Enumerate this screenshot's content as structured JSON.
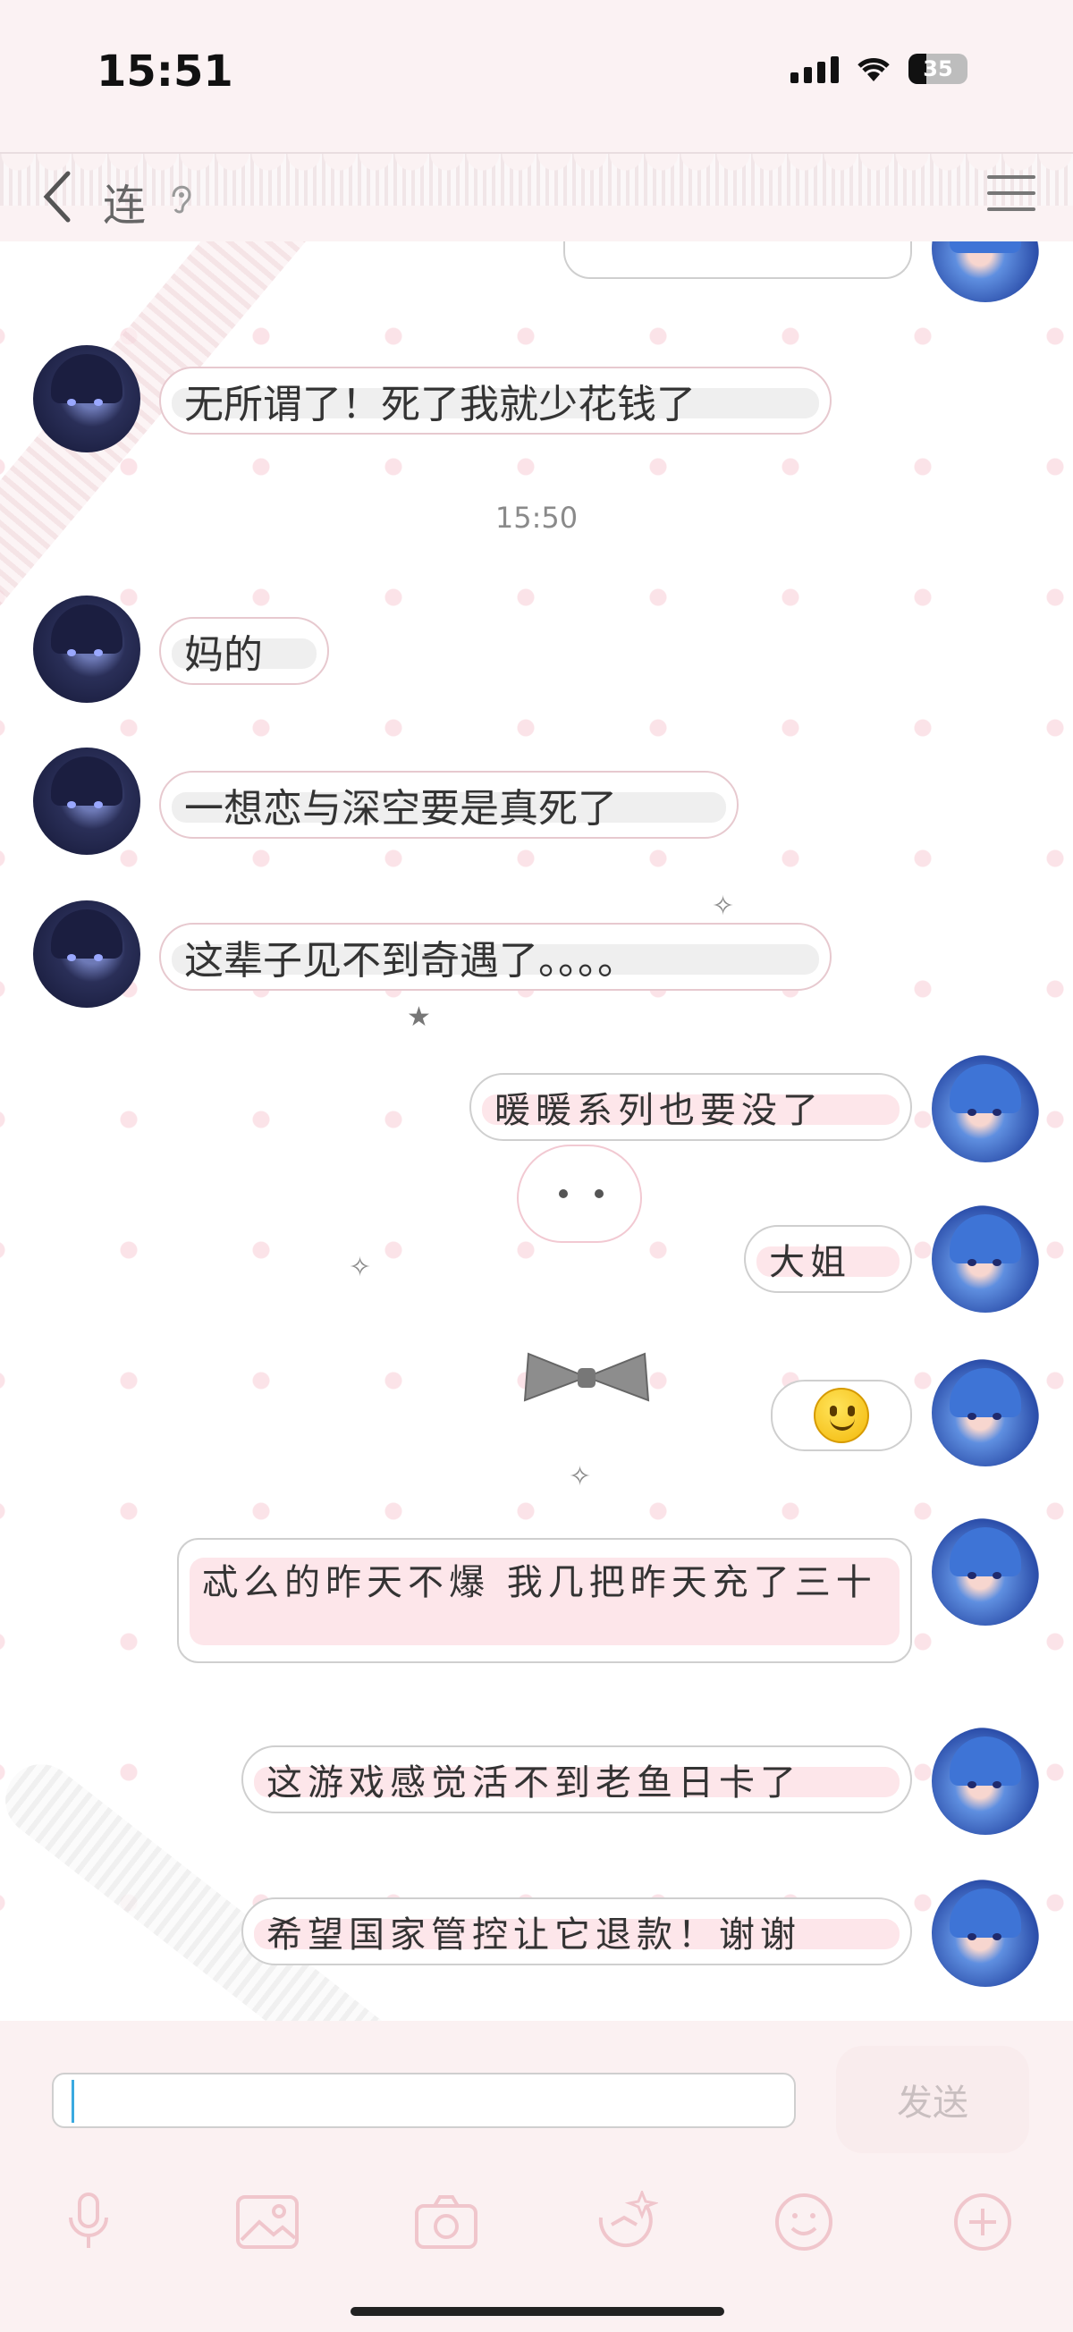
{
  "status_bar": {
    "time": "15:51",
    "battery": "35"
  },
  "header": {
    "contact_name": "连",
    "colors": {
      "background": "#fbf2f3",
      "text": "#666666"
    }
  },
  "timestamp": "15:50",
  "messages": [
    {
      "side": "left",
      "text": "无所谓了！死了我就少花钱了"
    },
    {
      "side": "left",
      "text": "妈的"
    },
    {
      "side": "left",
      "text": "一想恋与深空要是真死了"
    },
    {
      "side": "left",
      "text": "这辈子见不到奇遇了。。。。"
    },
    {
      "side": "right",
      "text": "暖暖系列也要没了"
    },
    {
      "side": "right",
      "text": "大姐"
    },
    {
      "side": "right",
      "text": "",
      "emoji": "smiley-face"
    },
    {
      "side": "right",
      "text": "忒么的昨天不爆 我几把昨天充了三十"
    },
    {
      "side": "right",
      "text": "这游戏感觉活不到老鱼日卡了"
    },
    {
      "side": "right",
      "text": "希望国家管控让它退款！谢谢"
    }
  ],
  "composer": {
    "input_value": "",
    "send_label": "发送"
  },
  "toolbar_icons": [
    "microphone-icon",
    "image-icon",
    "camera-icon",
    "sticker-icon",
    "emoji-icon",
    "plus-icon"
  ],
  "theme": {
    "bubble_border": "#e7c9cf",
    "highlight_left": "#efefef",
    "highlight_right": "#fde6ea",
    "dot": "#fbe3e8"
  }
}
